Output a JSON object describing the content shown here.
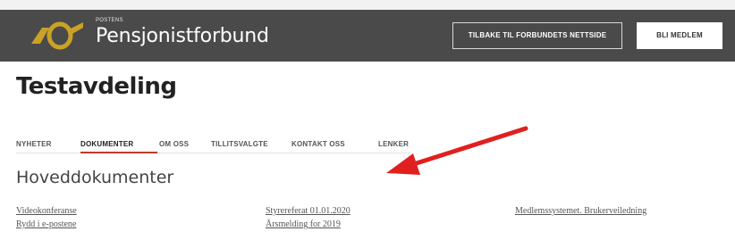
{
  "header": {
    "brand_small": "POSTENS",
    "brand_name": "Pensjonistforbund",
    "back_button": "TILBAKE TIL FORBUNDETS NETTSIDE",
    "join_button": "BLI MEDLEM"
  },
  "page": {
    "title": "Testavdeling"
  },
  "tabs": [
    {
      "label": "NYHETER"
    },
    {
      "label": "DOKUMENTER",
      "active": true
    },
    {
      "label": "OM OSS"
    },
    {
      "label": "TILLITSVALGTE"
    },
    {
      "label": "KONTAKT OSS"
    },
    {
      "label": "LENKER"
    }
  ],
  "section": {
    "title": "Hoveddokumenter"
  },
  "documents": {
    "col1": [
      "Videokonferanse",
      "Rydd i e-postene"
    ],
    "col2": [
      "Styrereferat 01.01.2020",
      "Årsmelding for 2019"
    ],
    "col3": [
      "Medlemssystemet. Brukerveiledning"
    ]
  },
  "colors": {
    "header_bg": "#4a4a4a",
    "logo_gold": "#c9a227",
    "active_tab_underline": "#c0392b",
    "annotation_arrow": "#e02020"
  },
  "icons": {
    "logo": "posthorn-logo-icon",
    "annotation": "red-arrow-annotation"
  }
}
